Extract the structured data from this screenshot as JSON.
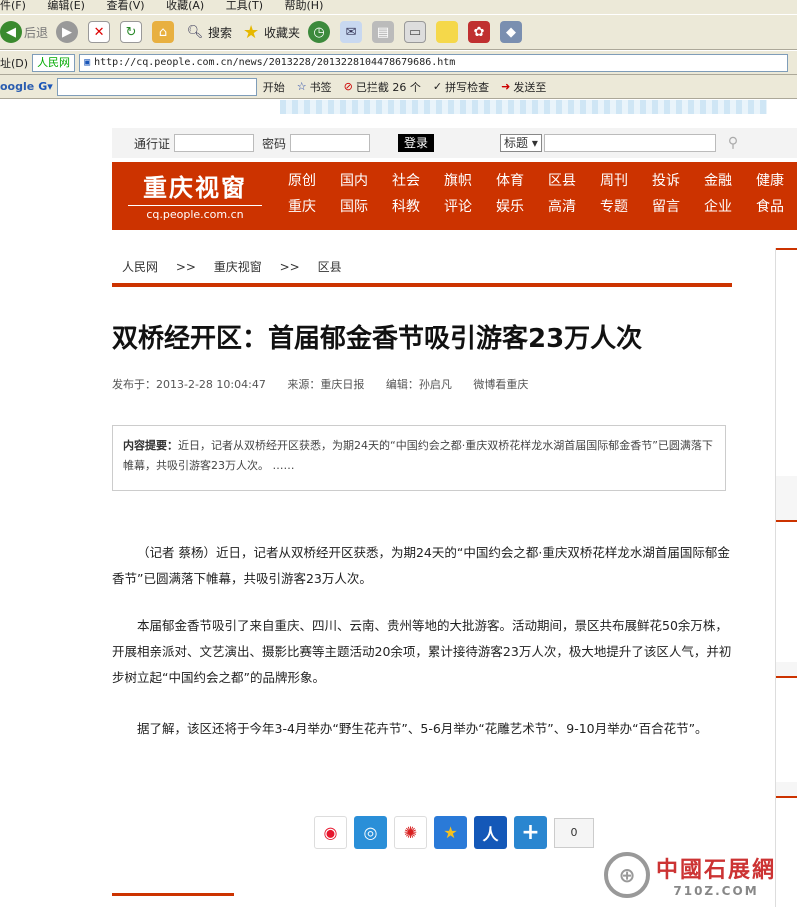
{
  "browser": {
    "menu": [
      "件(F)",
      "编辑(E)",
      "查看(V)",
      "收藏(A)",
      "工具(T)",
      "帮助(H)"
    ],
    "toolbar": {
      "back": "后退",
      "search": "搜索",
      "favorites": "收藏夹"
    },
    "address": {
      "label": "址(D)",
      "site_select": "人民网",
      "url": "http://cq.people.com.cn/news/2013228/2013228104478679686.htm"
    },
    "google_bar": {
      "brand": "oogle",
      "start": "开始",
      "bookmarks": "书签",
      "blocked": "已拦截 26 个",
      "spellcheck": "拼写检查",
      "send_to": "发送至"
    }
  },
  "login": {
    "user_label": "通行证",
    "pass_label": "密码",
    "login_button": "登录",
    "search_select": "标题"
  },
  "channel": {
    "logo_cn": "重庆视窗",
    "logo_url": "cq.people.com.cn",
    "nav_row1": [
      "原创",
      "国内",
      "社会",
      "旗帜",
      "体育",
      "区县",
      "周刊",
      "投诉",
      "金融",
      "健康"
    ],
    "nav_row2": [
      "重庆",
      "国际",
      "科教",
      "评论",
      "娱乐",
      "高清",
      "专题",
      "留言",
      "企业",
      "食品"
    ]
  },
  "breadcrumb": [
    "人民网",
    ">>",
    "重庆视窗",
    ">>",
    "区县"
  ],
  "article": {
    "title": "双桥经开区：首届郁金香节吸引游客23万人次",
    "published": "发布于：2013-2-28 10:04:47",
    "source": "来源：重庆日报",
    "editor": "编辑：孙启凡",
    "weibo": "微博看重庆",
    "summary_label": "内容提要：",
    "summary": "近日，记者从双桥经开区获悉，为期24天的“中国约会之都·重庆双桥花样龙水湖首届国际郁金香节”已圆满落下帷幕，共吸引游客23万人次。 ……",
    "paragraphs": [
      "（记者 蔡杨）近日，记者从双桥经开区获悉，为期24天的“中国约会之都·重庆双桥花样龙水湖首届国际郁金香节”已圆满落下帷幕，共吸引游客23万人次。",
      "本届郁金香节吸引了来自重庆、四川、云南、贵州等地的大批游客。活动期间，景区共布展鲜花50余万株，开展相亲派对、文艺演出、摄影比赛等主题活动20余项，累计接待游客23万人次，极大地提升了该区人气，并初步树立起“中国约会之都”的品牌形象。",
      "据了解，该区还将于今年3-4月举办“野生花卉节”、5-6月举办“花雕艺术节”、9-10月举办“百合花节”。"
    ]
  },
  "share": {
    "count": "0"
  },
  "watermark": {
    "name": "中國石展網",
    "url": "710Z.COM"
  },
  "colors": {
    "brand_red": "#cc3300",
    "chrome": "#ece9d8"
  }
}
